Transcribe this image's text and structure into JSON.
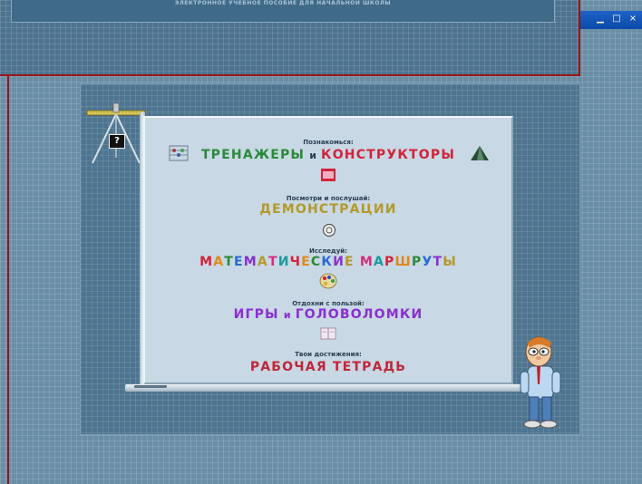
{
  "header": {
    "subtitle": "ЭЛЕКТРОННОЕ УЧЕБНОЕ ПОСОБИЕ ДЛЯ НАЧАЛЬНОЙ ШКОЛЫ"
  },
  "window_controls": [
    "minimize",
    "restore",
    "close"
  ],
  "help": {
    "label": "?"
  },
  "menu": {
    "trainers": {
      "intro": "Познакомься:",
      "word1": "ТРЕНАЖЕРЫ",
      "conj": "и",
      "word2": "КОНСТРУКТОРЫ",
      "color1": "#2a8a3a",
      "color2": "#d2243a"
    },
    "demos": {
      "intro": "Посмотри и послушай:",
      "title": "ДЕМОНСТРАЦИИ",
      "color": "#b39a2a"
    },
    "routes": {
      "intro": "Исследуй:",
      "title": "МАТЕМАТИЧЕСКИЕ МАРШРУТЫ"
    },
    "games": {
      "intro": "Отдохни с пользой:",
      "word1": "ИГРЫ",
      "conj": "и",
      "word2": "ГОЛОВОЛОМКИ",
      "color": "#8a2fd0"
    },
    "workbook": {
      "intro": "Твои достижения:",
      "title": "РАБОЧАЯ ТЕТРАДЬ",
      "color": "#c0263a"
    }
  },
  "colors": {
    "background": "#6a8ea6",
    "panel": "#4e7590",
    "board": "#c8d8e4",
    "accent_border": "#9a1414"
  }
}
